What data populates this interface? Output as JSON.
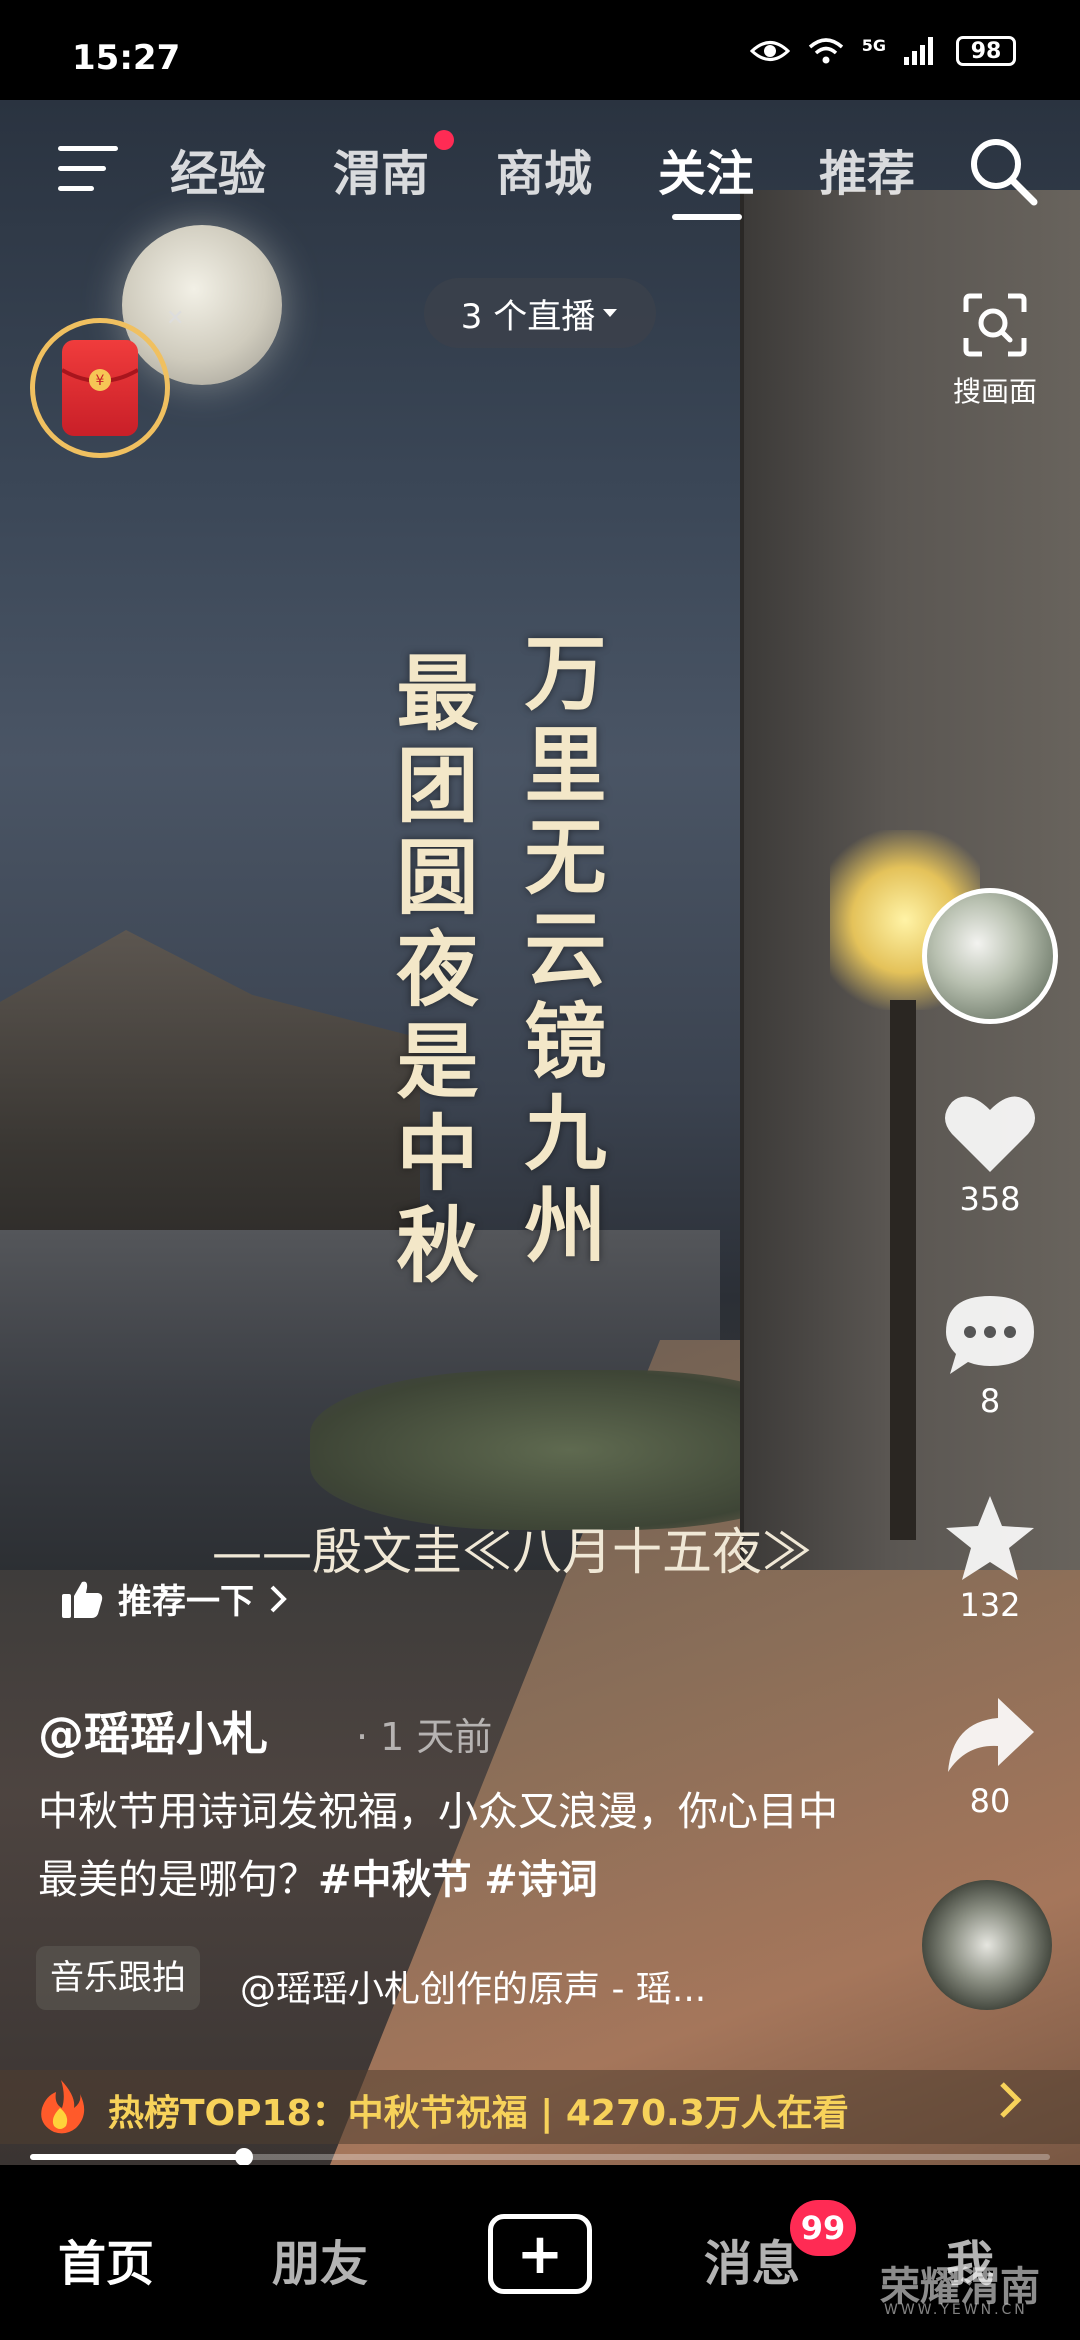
{
  "status": {
    "time": "15:27",
    "battery": "98",
    "network": "5G"
  },
  "nav": {
    "tabs": [
      "经验",
      "渭南",
      "商城",
      "关注",
      "推荐"
    ],
    "active_tab": "关注"
  },
  "live": {
    "label": "3 个直播"
  },
  "scan": {
    "label": "搜画面"
  },
  "poem": {
    "col_right": "万里无云镜九州",
    "col_left": "最团圆夜是中秋",
    "source": "——殷文圭≪八月十五夜≫"
  },
  "actions": {
    "likes": "358",
    "comments": "8",
    "favorites": "132",
    "shares": "80"
  },
  "recommend": {
    "label": "推荐一下"
  },
  "post": {
    "author": "@瑶瑶小札",
    "time": "1 天前",
    "caption": "中秋节用诗词发祝福，小众又浪漫，你心目中最美的是哪句？",
    "tag1": "#中秋节",
    "tag2": "#诗词"
  },
  "music": {
    "tag": "音乐跟拍",
    "text": "@瑶瑶小札创作的原声 - 瑶..."
  },
  "hot": {
    "text": "热榜TOP18：中秋节祝福 | 4270.3万人在看"
  },
  "progress": {
    "fraction": 0.21
  },
  "bottom": {
    "home": "首页",
    "friends": "朋友",
    "create": "+",
    "messages": "消息",
    "messages_badge": "99",
    "me": "我"
  },
  "watermark": {
    "text": "荣耀渭南",
    "sub": "WWW.YEWN.CN"
  },
  "colors": {
    "accent": "#ff2b54",
    "hot": "#f7d25a",
    "poem": "#f3e7c8"
  }
}
